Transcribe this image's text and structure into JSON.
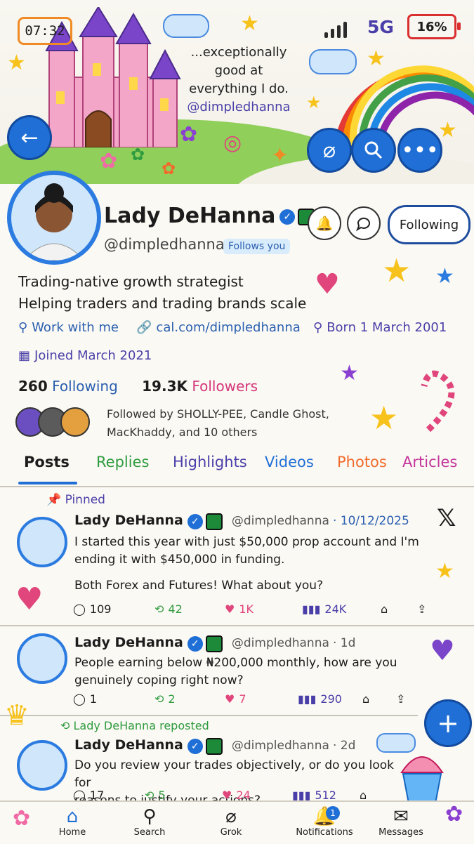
{
  "status_bar": {
    "time": "07:32",
    "network": "5G",
    "battery": "16%"
  },
  "banner": {
    "quote": "...exceptionally good at everything I do.",
    "quote_handle": "@dimpledhanna"
  },
  "profile": {
    "name": "Lady DeHanna",
    "handle": "@dimpledhanna",
    "follows_you": "Follows you",
    "following_button": "Following",
    "bio_line1": "Trading-native growth strategist",
    "bio_line2": "Helping traders and trading brands scale",
    "location": "Work with me",
    "link": "cal.com/dimpledhanna",
    "born": "Born 1 March 2001",
    "joined": "Joined March 2021",
    "following_count": "260",
    "following_label": "Following",
    "followers_count": "19.3K",
    "followers_label": "Followers",
    "followed_by_line1": "Followed by SHOLLY-PEE, Candle Ghost,",
    "followed_by_line2": "MacKhaddy, and 10 others"
  },
  "tabs": [
    "Posts",
    "Replies",
    "Highlights",
    "Videos",
    "Photos",
    "Articles"
  ],
  "posts": [
    {
      "context": "Pinned",
      "name": "Lady DeHanna",
      "handle": "@dimpledhanna",
      "date": "· 10/12/2025",
      "text1": "I started this year with just $50,000 prop account and I'm",
      "text2": "ending it with $450,000 in funding.",
      "text3": "Both Forex and Futures! What about you?",
      "replies": "109",
      "reposts": "42",
      "likes": "1K",
      "views": "24K"
    },
    {
      "name": "Lady DeHanna",
      "handle": "@dimpledhanna",
      "date": "· 1d",
      "text1": "People earning below ₦200,000 monthly, how are you",
      "text2": "genuinely coping right now?",
      "replies": "1",
      "reposts": "2",
      "likes": "7",
      "views": "290"
    },
    {
      "context": "Lady DeHanna reposted",
      "name": "Lady DeHanna",
      "handle": "@dimpledhanna",
      "date": "· 2d",
      "text1": "Do you review your trades objectively, or do you look for",
      "text2": "reasons to justify your actions?",
      "replies": "17",
      "reposts": "5",
      "likes": "24",
      "views": "512"
    }
  ],
  "nav": {
    "home": "Home",
    "search": "Search",
    "grok": "Grok",
    "notifications": "Notifications",
    "notifications_badge": "1",
    "messages": "Messages"
  },
  "colors": {
    "accent": "#1f6fd6",
    "repost": "#2e9b3e",
    "like": "#e0457b",
    "views": "#4a3fa8"
  }
}
